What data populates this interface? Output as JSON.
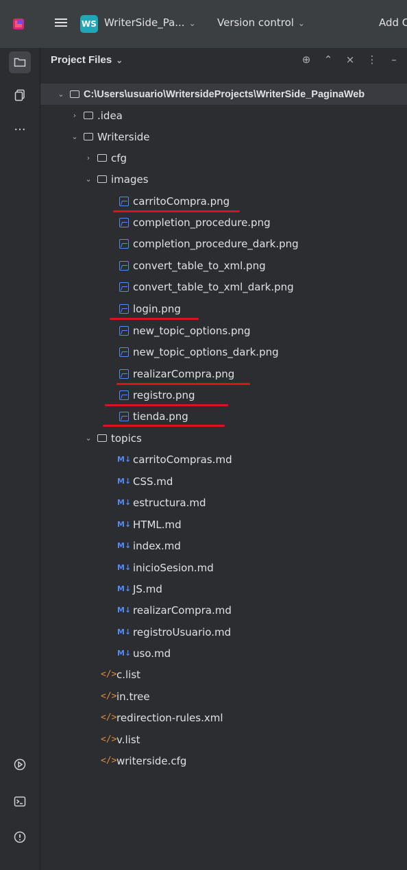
{
  "titlebar": {
    "project_badge": "WS",
    "project_name": "WriterSide_Pa...",
    "version_control": "Version control",
    "add_label": "Add C"
  },
  "panel": {
    "title": "Project Files"
  },
  "tree": {
    "root": "C:\\Users\\usuario\\WritersideProjects\\WriterSide_PaginaWeb",
    "idea": ".idea",
    "writerside": "Writerside",
    "cfg": "cfg",
    "images": "images",
    "image_files": [
      "carritoCompra.png",
      "completion_procedure.png",
      "completion_procedure_dark.png",
      "convert_table_to_xml.png",
      "convert_table_to_xml_dark.png",
      "login.png",
      "new_topic_options.png",
      "new_topic_options_dark.png",
      "realizarCompra.png",
      "registro.png",
      "tienda.png"
    ],
    "topics": "topics",
    "md_badge": "M↓",
    "topic_files": [
      "carritoCompras.md",
      "CSS.md",
      "estructura.md",
      "HTML.md",
      "index.md",
      "inicioSesion.md",
      "JS.md",
      "realizarCompra.md",
      "registroUsuario.md",
      "uso.md"
    ],
    "xml_badge": "</>",
    "config_files": [
      "c.list",
      "in.tree",
      "redirection-rules.xml",
      "v.list",
      "writerside.cfg"
    ]
  },
  "colors": {
    "accent": "#548af7",
    "underline": "#d9141e",
    "xml_icon": "#e08a3c"
  }
}
